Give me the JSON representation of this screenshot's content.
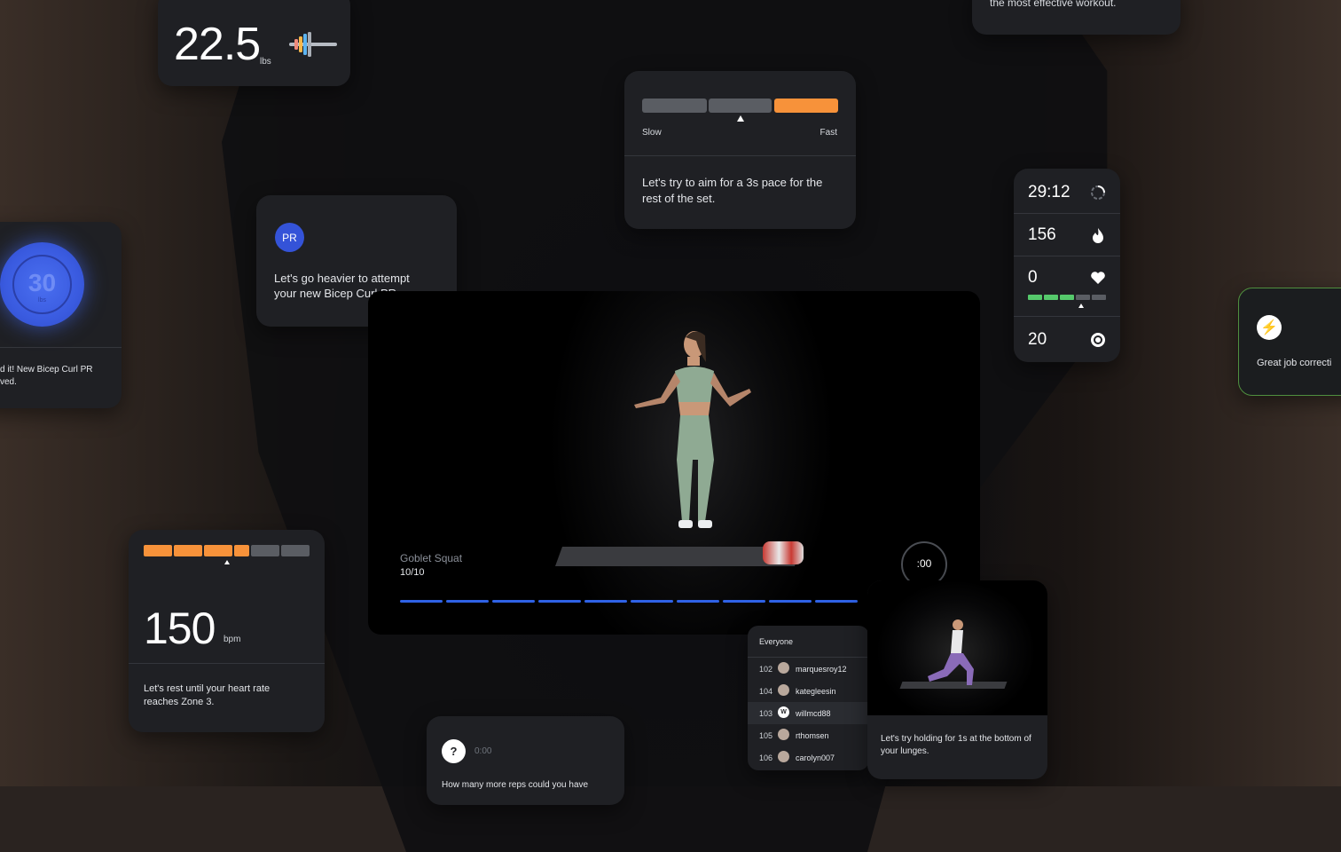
{
  "weight_card": {
    "value": "22.5",
    "unit": "lbs"
  },
  "pace_card": {
    "slow_label": "Slow",
    "fast_label": "Fast",
    "message": "Let's try to aim for a 3s pace for the rest of the set."
  },
  "pr_card": {
    "badge": "PR",
    "message": "Let's go heavier to attempt your new Bicep Curl PR."
  },
  "dial_card": {
    "value": "30",
    "unit": "lbs",
    "message_line1": "d it! New Bicep Curl PR",
    "message_line2": "ved."
  },
  "top_right_card": {
    "message": "the most effective workout."
  },
  "video": {
    "exercise": "Goblet Squat",
    "reps": "10/10",
    "timer": ":00",
    "progress_segments": 10
  },
  "stats": {
    "time": "29:12",
    "calories": "156",
    "heart_zone": "0",
    "reps": "20",
    "zone_level": 0.4
  },
  "job_card": {
    "message": "Great job correcti"
  },
  "heart_card": {
    "value": "150",
    "unit": "bpm",
    "message": "Let's rest until your heart rate reaches Zone 3.",
    "zone_level": 0.72
  },
  "leaderboard": {
    "header": "Everyone",
    "rows": [
      {
        "rank": "102",
        "avatar": "",
        "name": "marquesroy12"
      },
      {
        "rank": "104",
        "avatar": "",
        "name": "kategleesin"
      },
      {
        "rank": "103",
        "avatar": "W",
        "name": "willmcd88"
      },
      {
        "rank": "105",
        "avatar": "",
        "name": "rthomsen"
      },
      {
        "rank": "106",
        "avatar": "",
        "name": "carolyn007"
      }
    ]
  },
  "lunge_card": {
    "message": "Let's try holding for 1s at the bottom of your lunges."
  },
  "question_card": {
    "icon": "?",
    "time": "0:00",
    "message": "How many more reps could you have"
  },
  "colors": {
    "orange": "#f7923a",
    "green": "#55c96b",
    "blue": "#2f62e6",
    "card": "#1f2024",
    "pr_blue": "#3453d8"
  }
}
